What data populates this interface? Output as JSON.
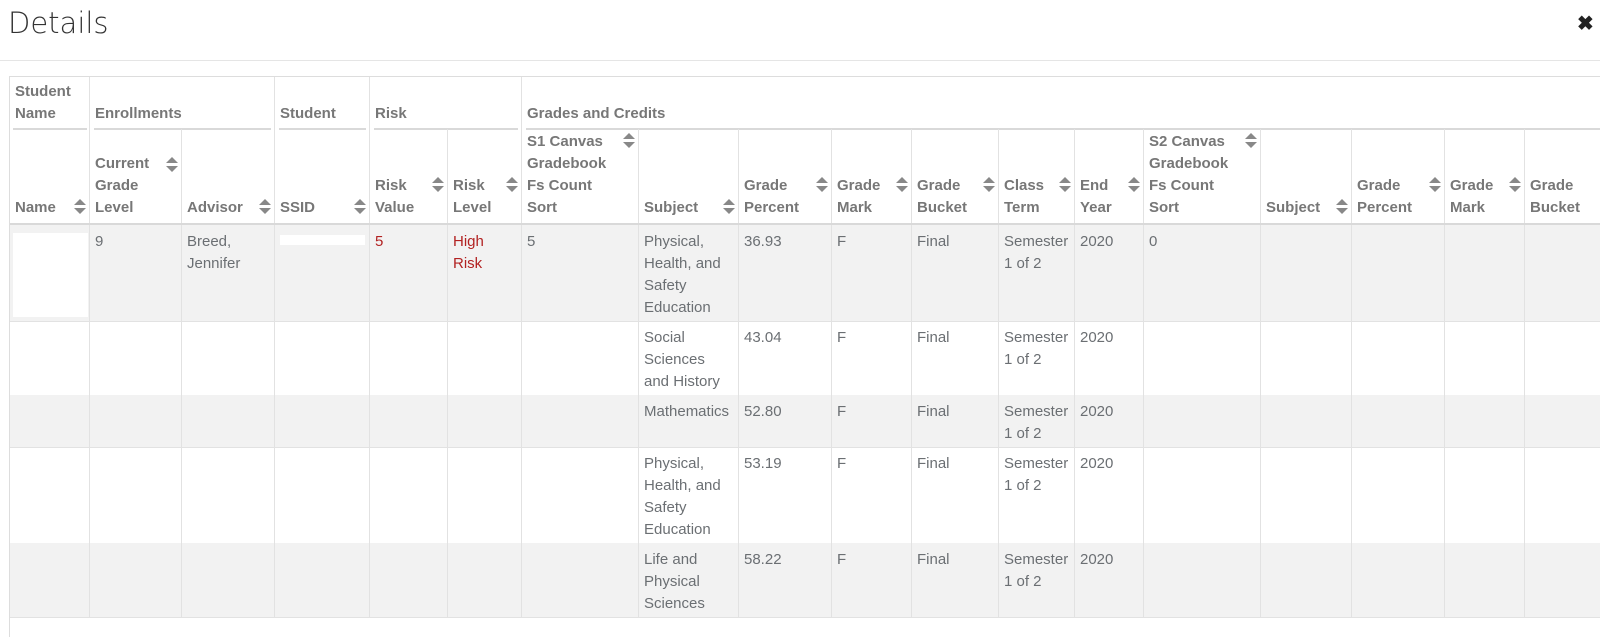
{
  "dialog": {
    "title": "Details",
    "close_glyph": "✖"
  },
  "group_headers": {
    "student_name": "Student Name",
    "enrollments": "Enrollments",
    "student": "Student",
    "risk": "Risk",
    "grades": "Grades and Credits"
  },
  "columns": {
    "name": "Name",
    "grade_level": "Current Grade Level",
    "advisor": "Advisor",
    "ssid": "SSID",
    "risk_value": "Risk Value",
    "risk_level": "Risk Level",
    "s1_count": "S1 Canvas Gradebook Fs Count Sort",
    "subject": "Subject",
    "grade_percent": "Grade Percent",
    "grade_mark": "Grade Mark",
    "grade_bucket": "Grade Bucket",
    "class_term": "Class Term",
    "end_year": "End Year",
    "s2_count": "S2 Canvas Gradebook Fs Count Sort",
    "s2_subject": "Subject",
    "s2_grade_percent": "Grade Percent",
    "s2_grade_mark": "Grade Mark",
    "s2_grade_bucket": "Grade Bucket"
  },
  "student": {
    "grade_level": "9",
    "advisor": "Breed, Jennifer",
    "risk_value": "5",
    "risk_level": "High Risk",
    "s1_count": "5",
    "s2_count": "0"
  },
  "rows": [
    {
      "subject": "Physical, Health, and Safety Education",
      "grade_percent": "36.93",
      "grade_mark": "F",
      "grade_bucket": "Final",
      "class_term": "Semester 1 of 2",
      "end_year": "2020"
    },
    {
      "subject": "Social Sciences and History",
      "grade_percent": "43.04",
      "grade_mark": "F",
      "grade_bucket": "Final",
      "class_term": "Semester 1 of 2",
      "end_year": "2020"
    },
    {
      "subject": "Mathematics",
      "grade_percent": "52.80",
      "grade_mark": "F",
      "grade_bucket": "Final",
      "class_term": "Semester 1 of 2",
      "end_year": "2020"
    },
    {
      "subject": "Physical, Health, and Safety Education",
      "grade_percent": "53.19",
      "grade_mark": "F",
      "grade_bucket": "Final",
      "class_term": "Semester 1 of 2",
      "end_year": "2020"
    },
    {
      "subject": "Life and Physical Sciences",
      "grade_percent": "58.22",
      "grade_mark": "F",
      "grade_bucket": "Final",
      "class_term": "Semester 1 of 2",
      "end_year": "2020"
    }
  ],
  "colors": {
    "risk_red": "#b22222",
    "row_shade": "#f2f2f2"
  }
}
